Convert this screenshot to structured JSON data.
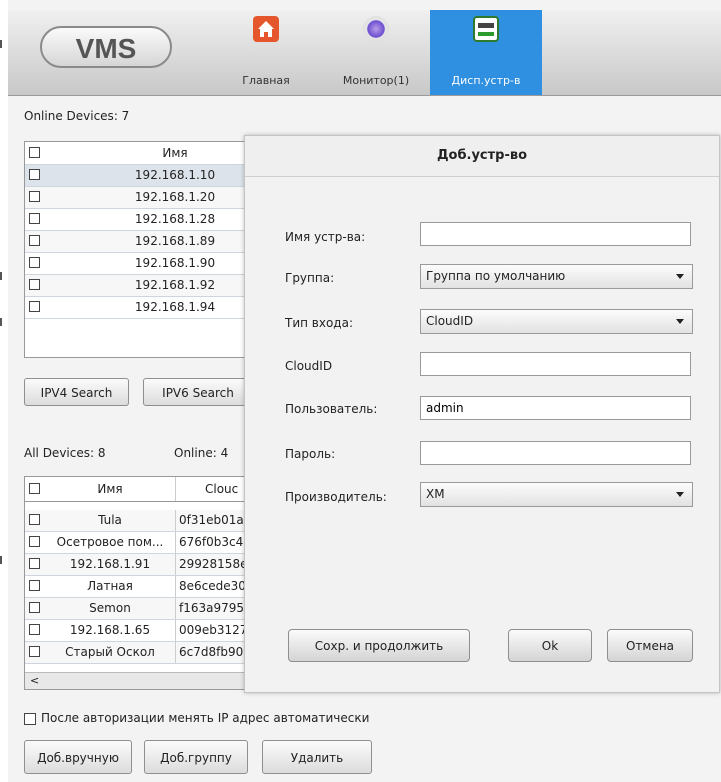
{
  "header": {
    "logo": "VMS",
    "nav": [
      {
        "label": "Главная",
        "icon": "home-icon"
      },
      {
        "label": "Монитор(1)",
        "icon": "monitor-icon"
      },
      {
        "label": "Дисп.устр-в",
        "icon": "device-manager-icon",
        "active": true
      }
    ],
    "active_color": "#2f8fe0"
  },
  "online_panel": {
    "title": "Online Devices: 7",
    "col_name": "Имя",
    "rows": [
      "192.168.1.10",
      "192.168.1.20",
      "192.168.1.28",
      "192.168.1.89",
      "192.168.1.90",
      "192.168.1.92",
      "192.168.1.94"
    ],
    "btn_ipv4": "IPV4 Search",
    "btn_ipv6": "IPV6 Search"
  },
  "all_panel": {
    "all_label": "All Devices: 8",
    "online_label": "Online: 4",
    "col_name": "Имя",
    "col_cloud": "Clouc",
    "rows": [
      {
        "name": "Tula",
        "cloud": "0f31eb01a"
      },
      {
        "name": "Осетровое пом...",
        "cloud": "676f0b3c4"
      },
      {
        "name": "192.168.1.91",
        "cloud": "29928158e"
      },
      {
        "name": "Латная",
        "cloud": "8e6cede30"
      },
      {
        "name": "Semon",
        "cloud": "f163a9795"
      },
      {
        "name": "192.168.1.65",
        "cloud": "009eb3127"
      },
      {
        "name": "Старый Оскол",
        "cloud": "6c7d8fb90"
      }
    ],
    "scroll_left": "<"
  },
  "footer": {
    "auto_ip_label": "После авторизации менять IP адрес автоматически",
    "btn_manual": "Доб.вручную",
    "btn_group": "Доб.группу",
    "btn_delete": "Удалить"
  },
  "dialog": {
    "title": "Доб.устр-во",
    "device_name_label": "Имя устр-ва:",
    "device_name_value": "",
    "group_label": "Группа:",
    "group_value": "Группа по умолчанию",
    "login_type_label": "Тип входа:",
    "login_type_value": "CloudID",
    "cloudid_label": "CloudID",
    "cloudid_value": "",
    "user_label": "Пользователь:",
    "user_value": "admin",
    "password_label": "Пароль:",
    "password_value": "",
    "vendor_label": "Производитель:",
    "vendor_value": "XM",
    "btn_save_continue": "Сохр. и продолжить",
    "btn_ok": "Ok",
    "btn_cancel": "Отмена"
  }
}
